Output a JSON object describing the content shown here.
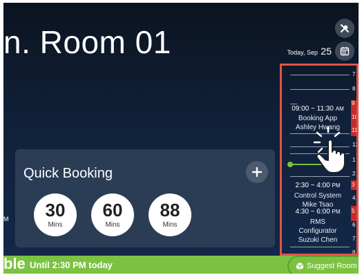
{
  "header": {
    "room_title": "n. Room 01",
    "date_label": "Today, Sep",
    "date_day": "25"
  },
  "icons": {
    "tools": "tools-icon",
    "calendar": "calendar-icon",
    "add": "plus-icon",
    "pointer": "hand-pointer-icon",
    "suggest": "cube-icon"
  },
  "timeline": {
    "hours": [
      "7",
      "8",
      "9",
      "10",
      "11",
      "12",
      "1",
      "2",
      "3",
      "4",
      "5",
      "6",
      "7",
      "8"
    ],
    "bookings": [
      {
        "time": "09:00 ~ 11:30",
        "ampm": "AM",
        "title": "Booking App",
        "organizer": "Ashley Hwang"
      },
      {
        "time": "2:30 ~ 4:00",
        "ampm": "PM",
        "title": "Control System",
        "organizer": "Mike Tsao"
      },
      {
        "time": "4:30 ~ 6:00",
        "ampm": "PM",
        "title": "RMS",
        "detail": "Configurator",
        "organizer": "Suzuki Chen"
      }
    ]
  },
  "quick_booking": {
    "title": "Quick Booking",
    "options": [
      {
        "value": "30",
        "unit": "Mins"
      },
      {
        "value": "60",
        "unit": "Mins"
      },
      {
        "value": "88",
        "unit": "Mins"
      }
    ]
  },
  "left_fragment": "M",
  "status": {
    "fragment": "ble",
    "until": "Until 2:30 PM today",
    "suggest_label": "Suggest Room",
    "color": "#7cc242"
  },
  "colors": {
    "accent_red": "#e05545",
    "booking_red": "#c92a2a",
    "now_green": "#7bc23d"
  }
}
